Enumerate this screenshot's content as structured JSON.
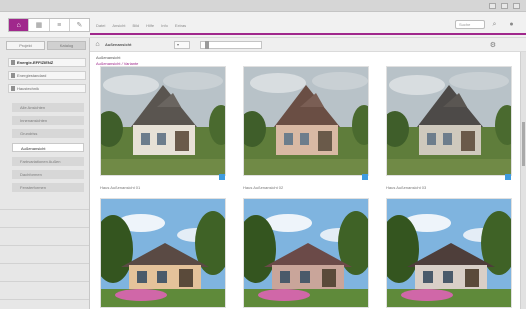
{
  "window": {
    "title": ""
  },
  "toolbar": {
    "icons": [
      "house-icon",
      "grid-icon",
      "layers-icon",
      "tools-icon"
    ],
    "menu": [
      "Datei",
      "Ansicht",
      "Bild",
      "Hilfe",
      "Info",
      "Extras"
    ],
    "search_placeholder": "Suche"
  },
  "sidebar": {
    "tabs": [
      "Projekt",
      "Katalog"
    ],
    "sections": [
      {
        "label": "Energie-EFFIZIENZ",
        "bold": true
      },
      {
        "label": "Energiestandard",
        "bold": false
      },
      {
        "label": "Haustechnik",
        "bold": false
      }
    ],
    "items": [
      {
        "label": "Alle Ansichten",
        "selected": false
      },
      {
        "label": "Innenansichten",
        "selected": false
      },
      {
        "label": "Grundriss",
        "selected": false
      },
      {
        "label": "Außenansicht",
        "selected": true
      },
      {
        "label": "Farbvariationen Außen",
        "selected": false
      },
      {
        "label": "Dachformen",
        "selected": false
      },
      {
        "label": "Fensterformen",
        "selected": false
      }
    ]
  },
  "content": {
    "title": "Außenansicht",
    "dropdown_value": "",
    "breadcrumb_primary": "Außenansicht",
    "breadcrumb_secondary": "Außenansicht / Variante",
    "cards": [
      {
        "caption": "Haus Außenansicht 01",
        "scene": "cloudy"
      },
      {
        "caption": "Haus Außenansicht 02",
        "scene": "cloudy"
      },
      {
        "caption": "Haus Außenansicht 03",
        "scene": "cloudy"
      },
      {
        "caption": "",
        "scene": "blue"
      },
      {
        "caption": "",
        "scene": "blue"
      },
      {
        "caption": "",
        "scene": "blue"
      }
    ]
  },
  "colors": {
    "accent": "#a0288c",
    "badge": "#3e9be0"
  }
}
